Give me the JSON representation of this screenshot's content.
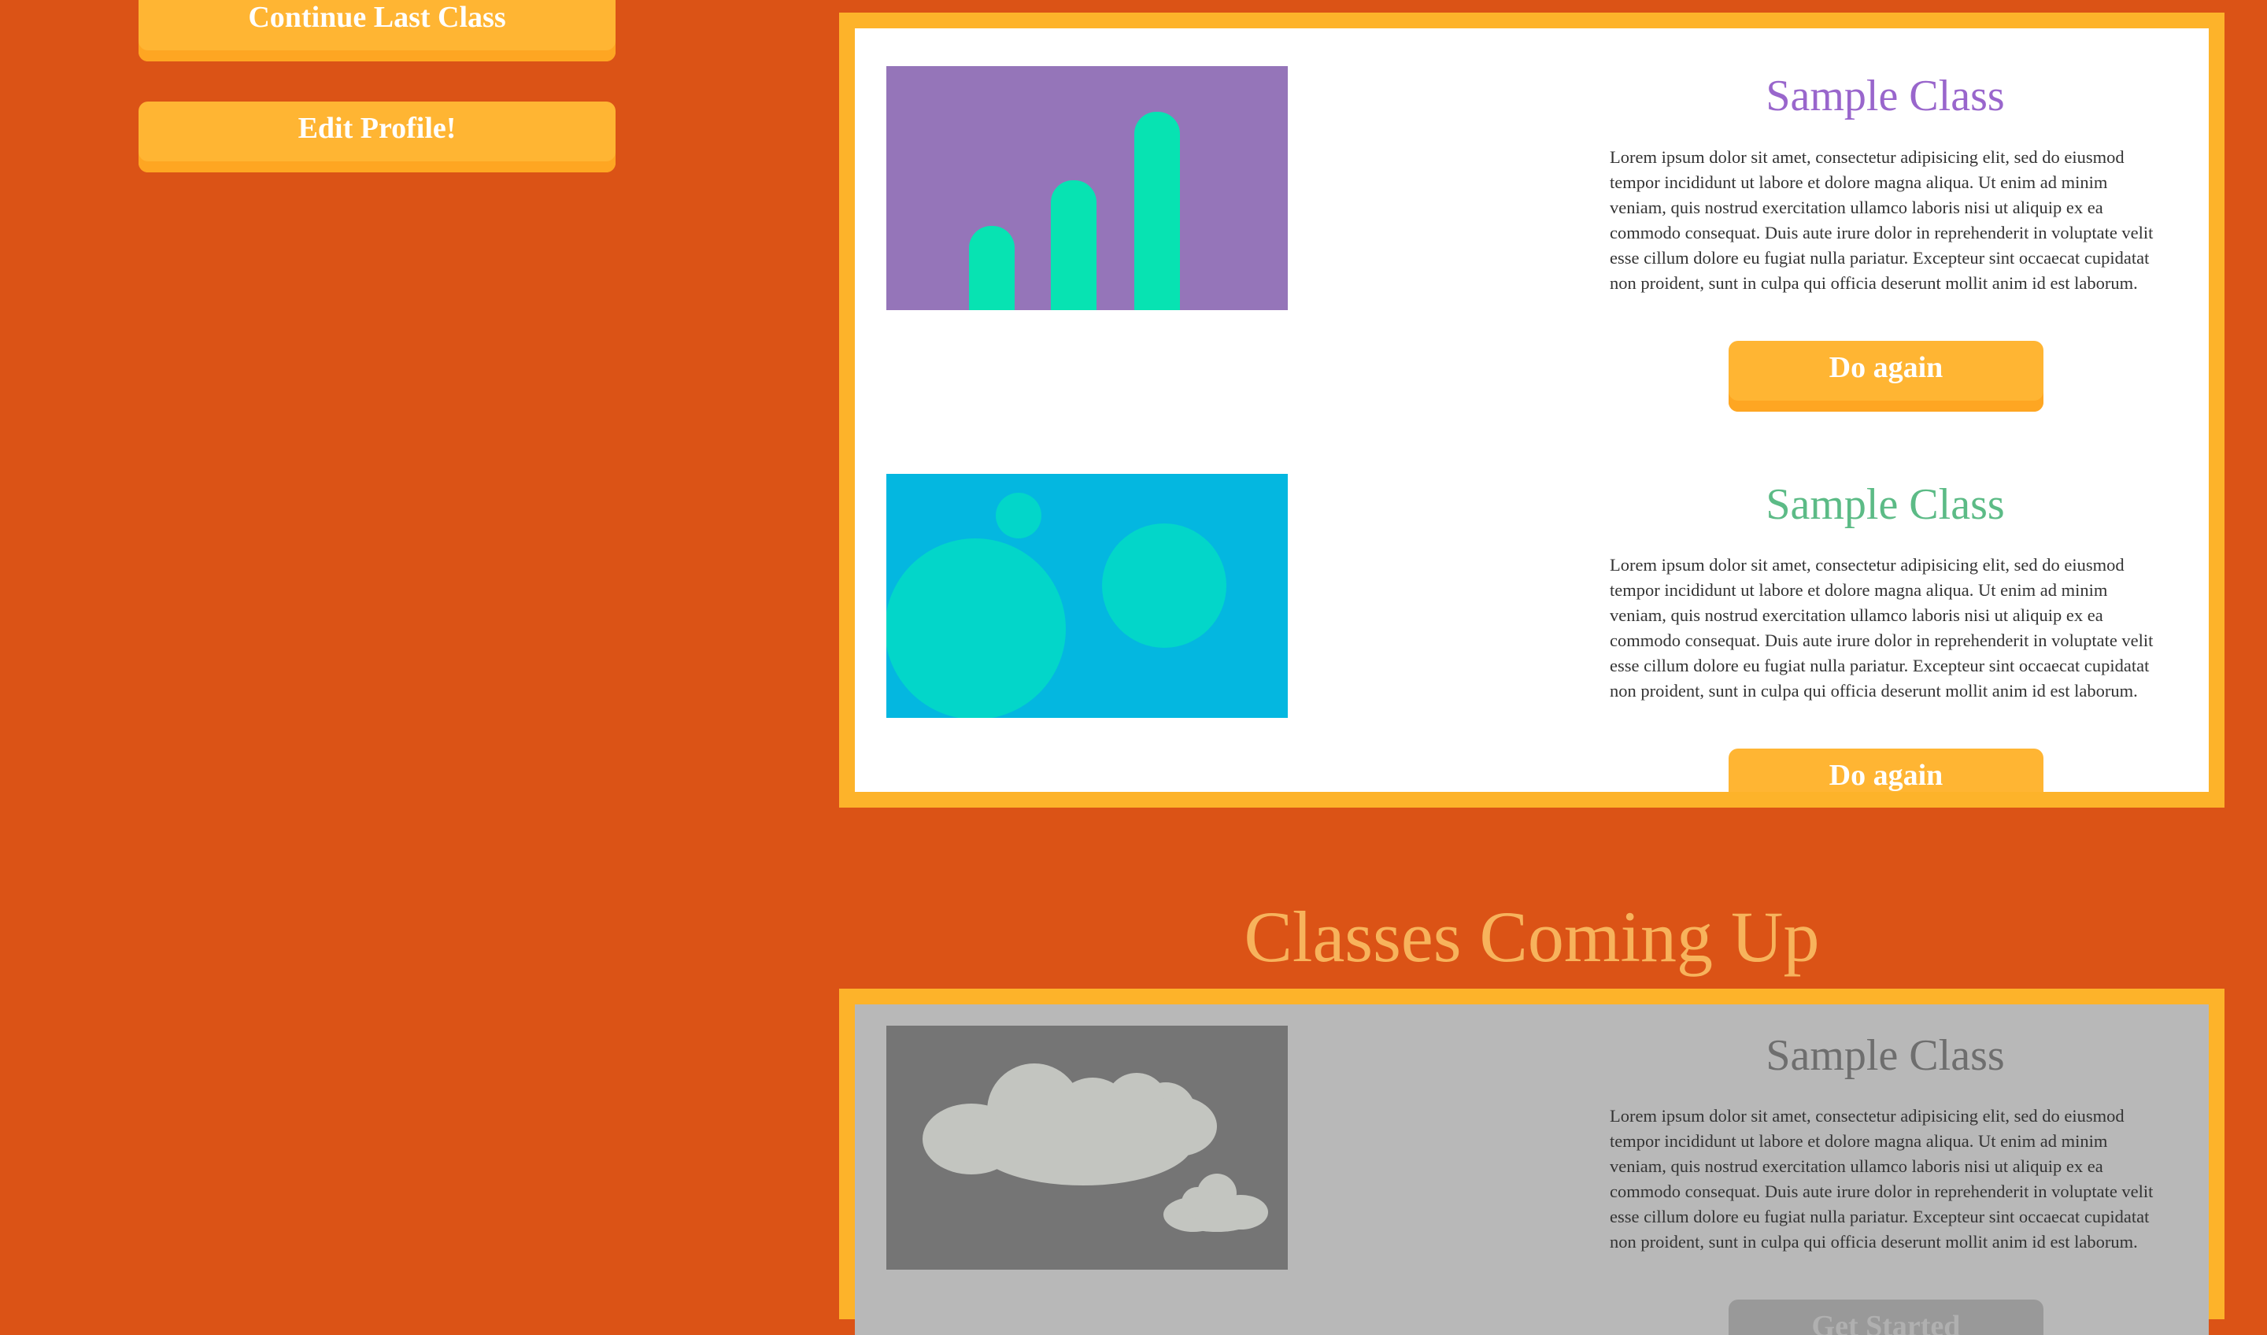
{
  "sidebar": {
    "continue_label": "Continue Last Class",
    "edit_profile_label": "Edit Profile!"
  },
  "completed_classes": [
    {
      "title": "Sample Class",
      "title_color": "#9966cc",
      "description": "Lorem ipsum dolor sit amet, consectetur adipisicing elit, sed do eiusmod tempor incididunt ut labore et dolore magna aliqua. Ut enim ad minim veniam, quis nostrud exercitation ullamco laboris nisi ut aliquip ex ea commodo consequat. Duis aute irure dolor in reprehenderit in voluptate velit esse cillum dolore eu fugiat nulla pariatur. Excepteur sint occaecat cupidatat non proident, sunt in culpa qui officia deserunt mollit anim id est laborum.",
      "button_label": "Do again",
      "image_icon": "bar-chart-illustration"
    },
    {
      "title": "Sample Class",
      "title_color": "#5cbb86",
      "description": "Lorem ipsum dolor sit amet, consectetur adipisicing elit, sed do eiusmod tempor incididunt ut labore et dolore magna aliqua. Ut enim ad minim veniam, quis nostrud exercitation ullamco laboris nisi ut aliquip ex ea commodo consequat. Duis aute irure dolor in reprehenderit in voluptate velit esse cillum dolore eu fugiat nulla pariatur. Excepteur sint occaecat cupidatat non proident, sunt in culpa qui officia deserunt mollit anim id est laborum.",
      "button_label": "Do again",
      "image_icon": "bubbles-illustration"
    }
  ],
  "upcoming": {
    "heading": "Classes Coming Up",
    "classes": [
      {
        "title": "Sample Class",
        "title_color": "#6e6e6e",
        "description": "Lorem ipsum dolor sit amet, consectetur adipisicing elit, sed do eiusmod tempor incididunt ut labore et dolore magna aliqua. Ut enim ad minim veniam, quis nostrud exercitation ullamco laboris nisi ut aliquip ex ea commodo consequat. Duis aute irure dolor in reprehenderit in voluptate velit esse cillum dolore eu fugiat nulla pariatur. Excepteur sint occaecat cupidatat non proident, sunt in culpa qui officia deserunt mollit anim id est laborum.",
        "button_label": "Get Started",
        "image_icon": "clouds-illustration"
      }
    ]
  },
  "colors": {
    "background": "#db5316",
    "panel_border": "#fdb32a",
    "button": "#ffb533",
    "heading": "#f7b35c"
  }
}
